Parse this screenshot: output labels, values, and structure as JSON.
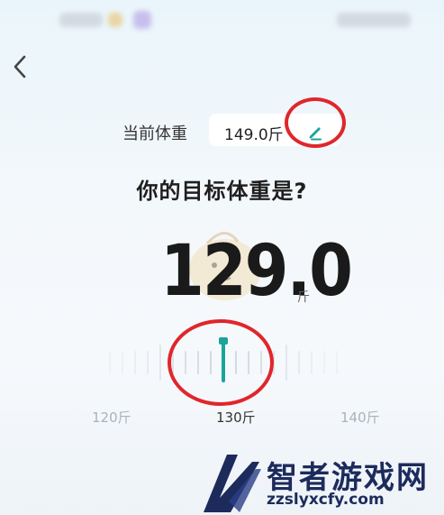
{
  "header": {
    "back_icon": "chevron-left-icon"
  },
  "current_weight": {
    "label": "当前体重",
    "value": "149.0斤",
    "edit_icon": "pencil-icon"
  },
  "question": "你的目标体重是?",
  "target": {
    "value": "129.0",
    "unit": "斤"
  },
  "ruler": {
    "min_label": "120斤",
    "mid_label": "130斤",
    "max_label": "140斤",
    "selected": 129.0,
    "pointer_color": "#1aa49a"
  },
  "watermark": {
    "title": "智者游戏网",
    "url": "zzslyxcfy.com"
  },
  "colors": {
    "accent": "#1aa49a",
    "highlight_ring": "#e0262b"
  }
}
